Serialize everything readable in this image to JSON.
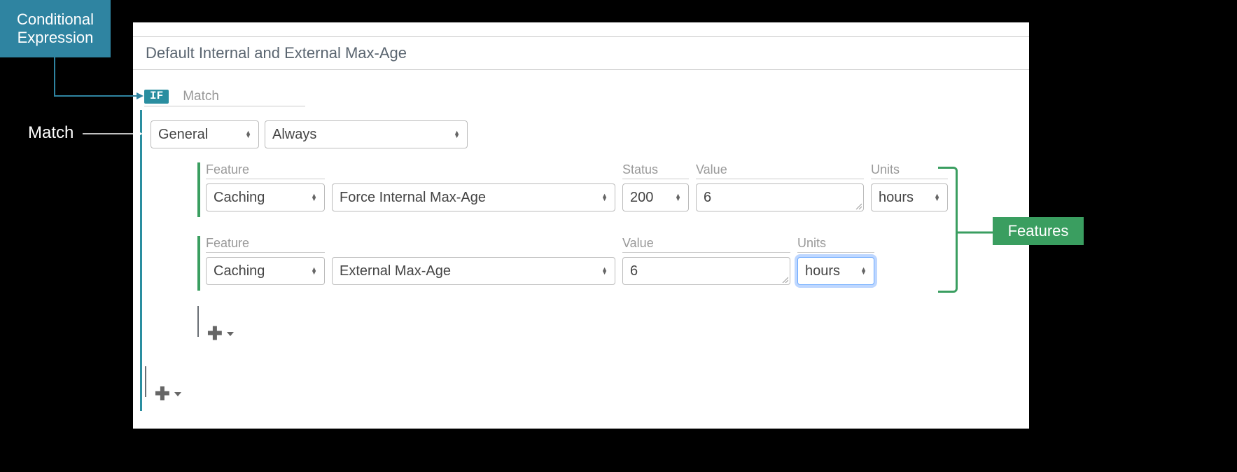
{
  "callouts": {
    "conditional_line1": "Conditional",
    "conditional_line2": "Expression",
    "match_label": "Match",
    "features_label": "Features"
  },
  "title": "Default Internal and External Max-Age",
  "if_badge": "IF",
  "if_header_label": "Match",
  "match": {
    "category": "General",
    "condition": "Always"
  },
  "features": [
    {
      "labels": {
        "feature": "Feature",
        "status": "Status",
        "value": "Value",
        "units": "Units"
      },
      "category": "Caching",
      "name": "Force Internal Max-Age",
      "status": "200",
      "value": "6",
      "units": "hours"
    },
    {
      "labels": {
        "feature": "Feature",
        "value": "Value",
        "units": "Units"
      },
      "category": "Caching",
      "name": "External Max-Age",
      "value": "6",
      "units": "hours",
      "units_focused": true
    }
  ]
}
